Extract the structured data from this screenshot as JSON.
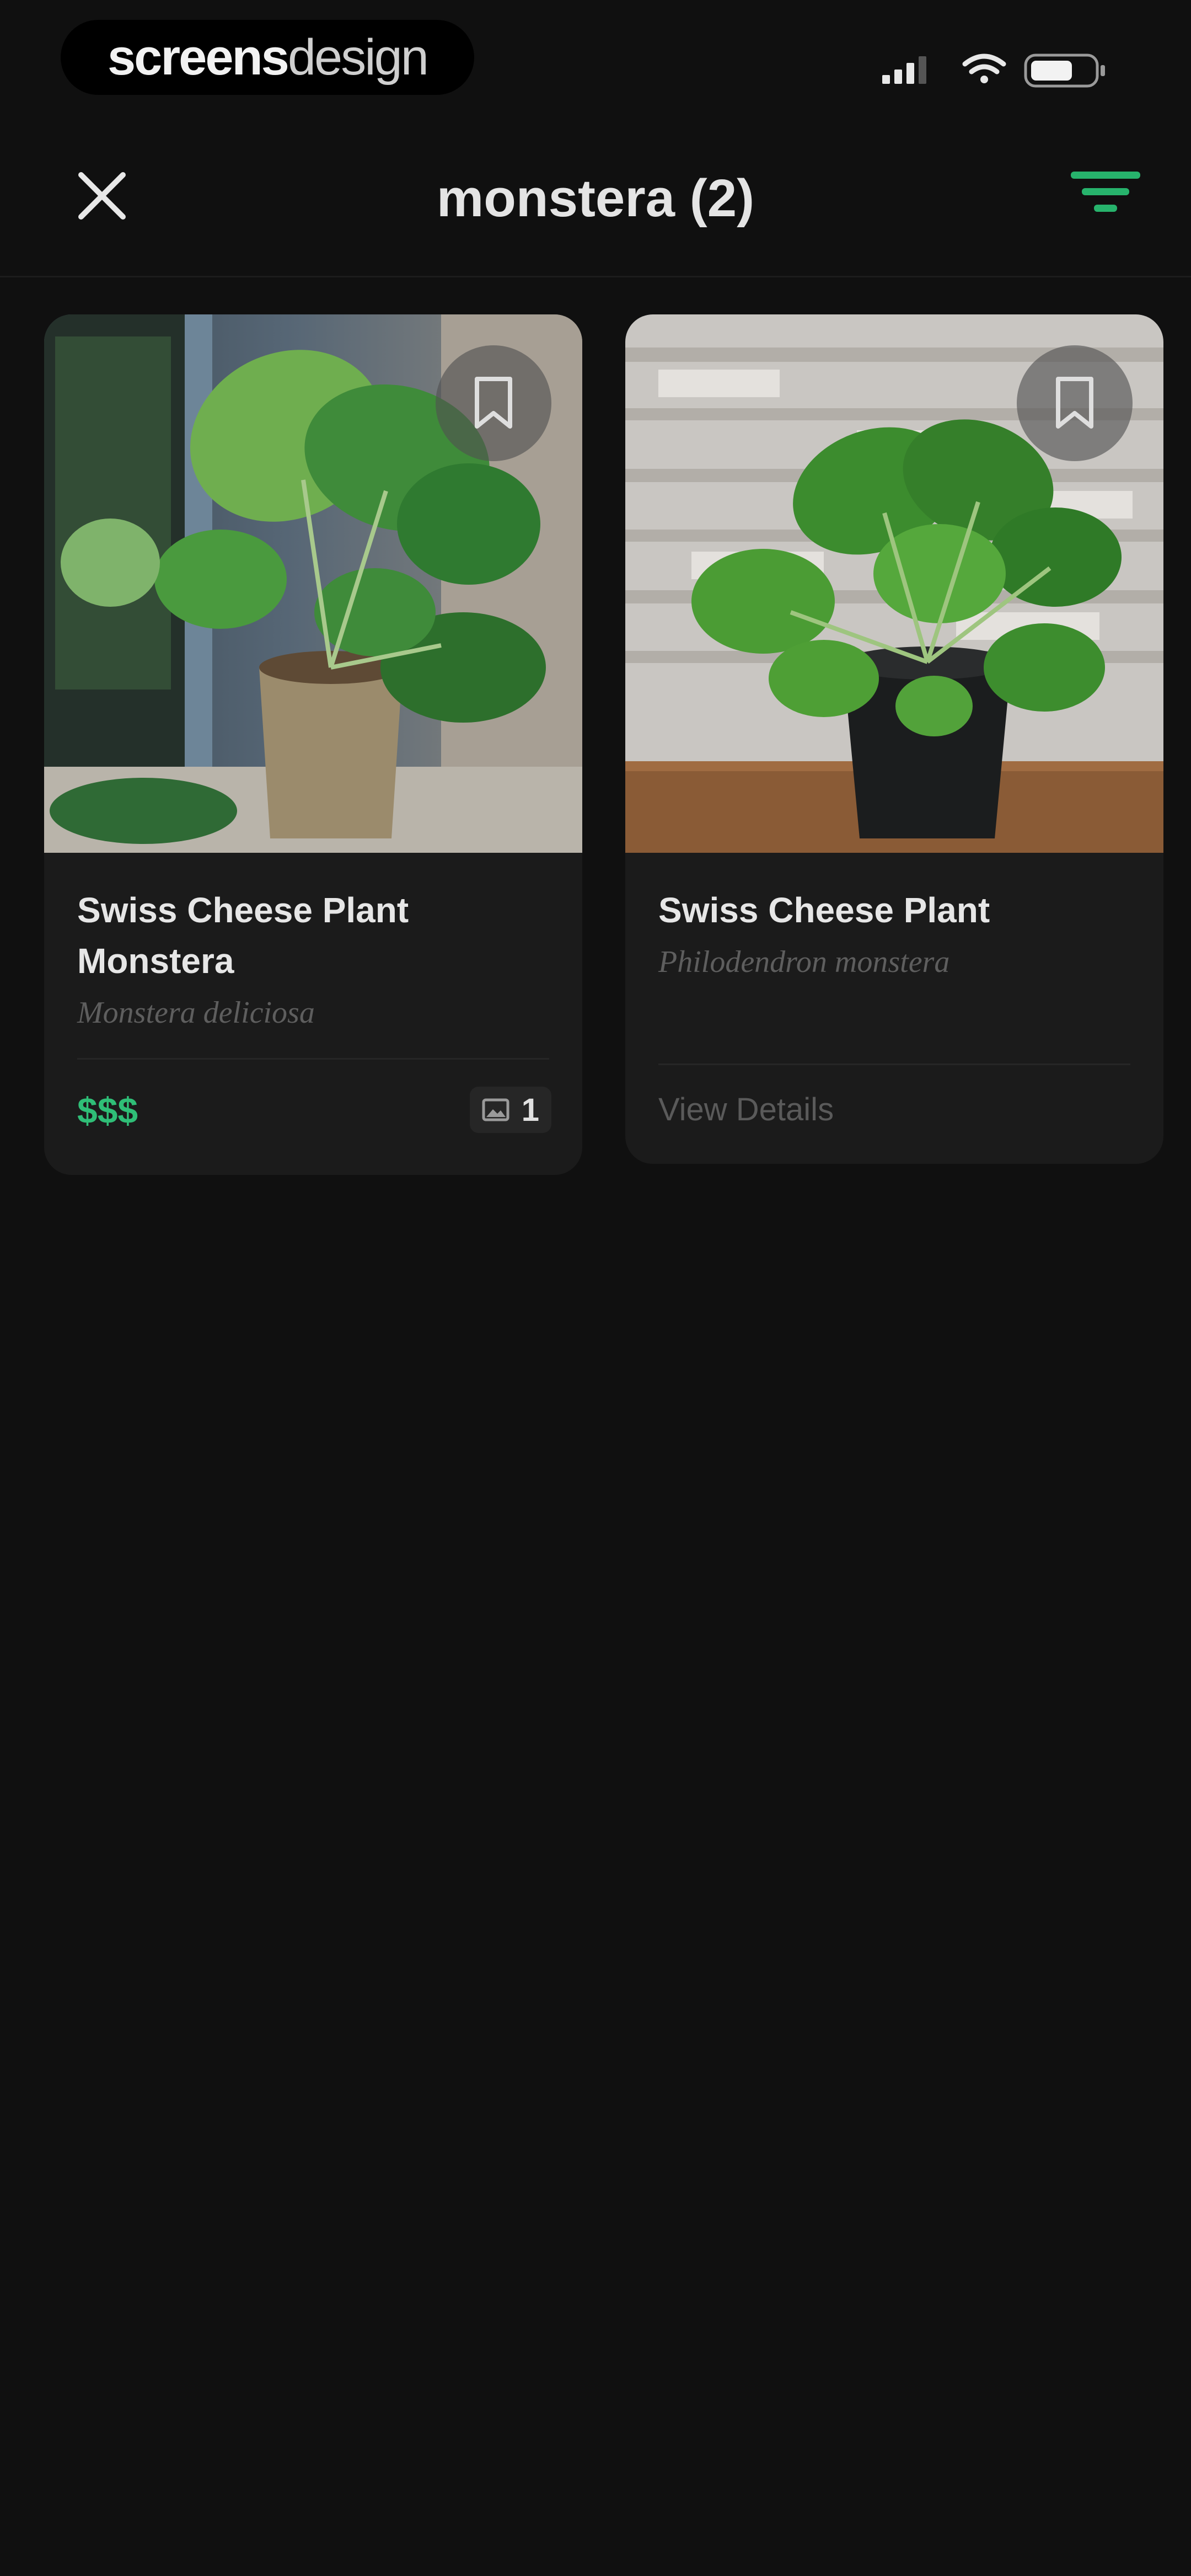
{
  "status_bar": {
    "brand_bold": "screens",
    "brand_light": "design",
    "icons": [
      "signal-icon",
      "wifi-icon",
      "battery-icon"
    ]
  },
  "header": {
    "title": "monstera (2)",
    "close_icon": "close-icon",
    "filter_icon": "filter-icon"
  },
  "results": [
    {
      "name": "Swiss Cheese Plant Monstera",
      "scientific_name": "Monstera deliciosa",
      "price": "$$$",
      "count": "1",
      "count_icon": "image-icon",
      "bookmark_icon": "bookmark-icon"
    },
    {
      "name": "Swiss Cheese Plant",
      "scientific_name": "Philodendron monstera",
      "link_label": "View Details",
      "bookmark_icon": "bookmark-icon"
    }
  ],
  "colors": {
    "background": "#101010",
    "card": "#1b1b1b",
    "accent_green": "#2fbe77"
  }
}
